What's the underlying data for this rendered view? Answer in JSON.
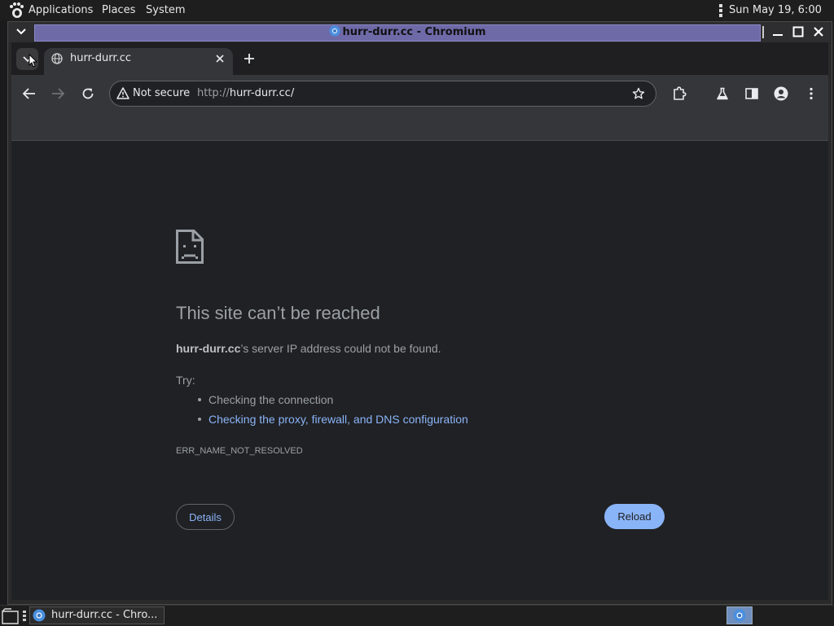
{
  "top_panel": {
    "menus": [
      "Applications",
      "Places",
      "System"
    ],
    "clock": "Sun May 19,  6:00 AM"
  },
  "window": {
    "title": "hurr-durr.cc - Chromium"
  },
  "browser": {
    "tab": {
      "title": "hurr-durr.cc"
    },
    "omnibox": {
      "security_label": "Not secure",
      "url_scheme": "http://",
      "url_host": "hurr-durr.cc/"
    },
    "colors": {
      "accent": "#8ab4f8",
      "content_bg": "#202124",
      "toolbar_bg": "#35363a"
    }
  },
  "error_page": {
    "heading": "This site can’t be reached",
    "host": "hurr-durr.cc",
    "message_suffix": "’s server IP address could not be found.",
    "try_label": "Try:",
    "suggestions": [
      "Checking the connection",
      "Checking the proxy, firewall, and DNS configuration"
    ],
    "error_code": "ERR_NAME_NOT_RESOLVED",
    "details_label": "Details",
    "reload_label": "Reload"
  },
  "taskbar": {
    "item_label": "hurr-durr.cc - Chro..."
  }
}
